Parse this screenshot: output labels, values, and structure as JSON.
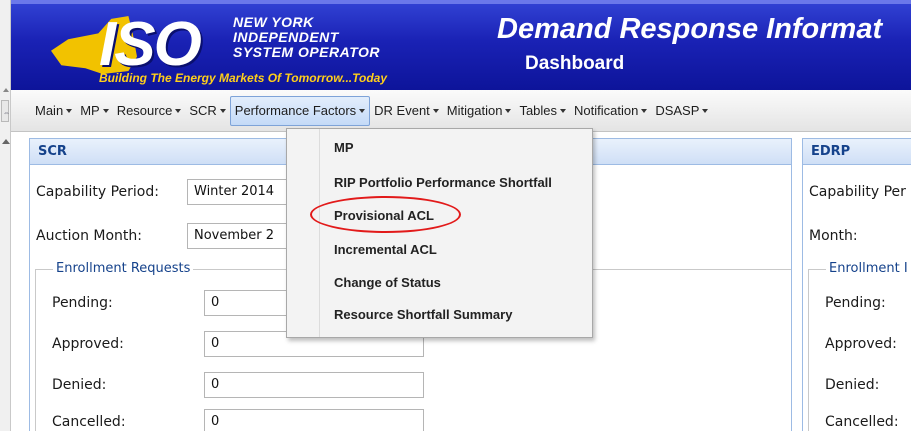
{
  "header": {
    "logo_text": "ISO",
    "org_lines": [
      "NEW YORK",
      "INDEPENDENT",
      "SYSTEM OPERATOR"
    ],
    "tagline": "Building The Energy Markets Of Tomorrow...Today",
    "app_title": "Demand Response Informat",
    "page_subtitle": "Dashboard",
    "colors": {
      "banner": "#1a22b5",
      "tagline": "#ffcf1a",
      "logo_state": "#f2c200"
    }
  },
  "menu": {
    "items": [
      {
        "label": "Main"
      },
      {
        "label": "MP"
      },
      {
        "label": "Resource"
      },
      {
        "label": "SCR"
      },
      {
        "label": "Performance Factors",
        "active": true
      },
      {
        "label": "DR Event"
      },
      {
        "label": "Mitigation"
      },
      {
        "label": "Tables"
      },
      {
        "label": "Notification"
      },
      {
        "label": "DSASP"
      }
    ]
  },
  "dropdown": {
    "items": [
      {
        "label": "MP"
      },
      {
        "label": "RIP Portfolio Performance Shortfall"
      },
      {
        "label": "Provisional ACL",
        "circled": true
      },
      {
        "label": "Incremental ACL"
      },
      {
        "label": "Change of Status"
      },
      {
        "label": "Resource Shortfall Summary"
      }
    ],
    "highlight_color": "#e21a1a"
  },
  "scr_panel": {
    "title": "SCR",
    "capability_period_label": "Capability Period:",
    "capability_period_value": "Winter 2014",
    "auction_month_label": "Auction Month:",
    "auction_month_value": "November 2",
    "enrollment_legend": "Enrollment Requests",
    "rows": [
      {
        "label": "Pending:",
        "value": "0"
      },
      {
        "label": "Approved:",
        "value": "0"
      },
      {
        "label": "Denied:",
        "value": "0"
      },
      {
        "label": "Cancelled:",
        "value": "0"
      }
    ]
  },
  "edrp_panel": {
    "title": "EDRP",
    "capability_period_label": "Capability Per",
    "month_label": "Month:",
    "enrollment_legend": "Enrollment I",
    "rows": [
      {
        "label": "Pending:"
      },
      {
        "label": "Approved:"
      },
      {
        "label": "Denied:"
      },
      {
        "label": "Cancelled:"
      }
    ]
  }
}
